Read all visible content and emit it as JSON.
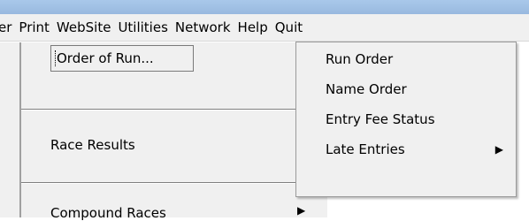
{
  "menubar": {
    "items": [
      {
        "label": "er",
        "name": "menu-partial"
      },
      {
        "label": "Print",
        "name": "menu-print"
      },
      {
        "label": "WebSite",
        "name": "menu-website"
      },
      {
        "label": "Utilities",
        "name": "menu-utilities"
      },
      {
        "label": "Network",
        "name": "menu-network"
      },
      {
        "label": "Help",
        "name": "menu-help"
      },
      {
        "label": "Quit",
        "name": "menu-quit"
      }
    ]
  },
  "panel": {
    "order_of_run_button": "Order of Run...",
    "race_results": "Race Results",
    "compound_races": "Compound Races"
  },
  "dropdown": {
    "items": [
      {
        "label": "Run Order",
        "submenu": false
      },
      {
        "label": "Name Order",
        "submenu": false
      },
      {
        "label": "Entry Fee Status",
        "submenu": false
      },
      {
        "label": "Late Entries",
        "submenu": true
      }
    ]
  },
  "icons": {
    "submenu_arrow": "triangle-right-icon"
  }
}
